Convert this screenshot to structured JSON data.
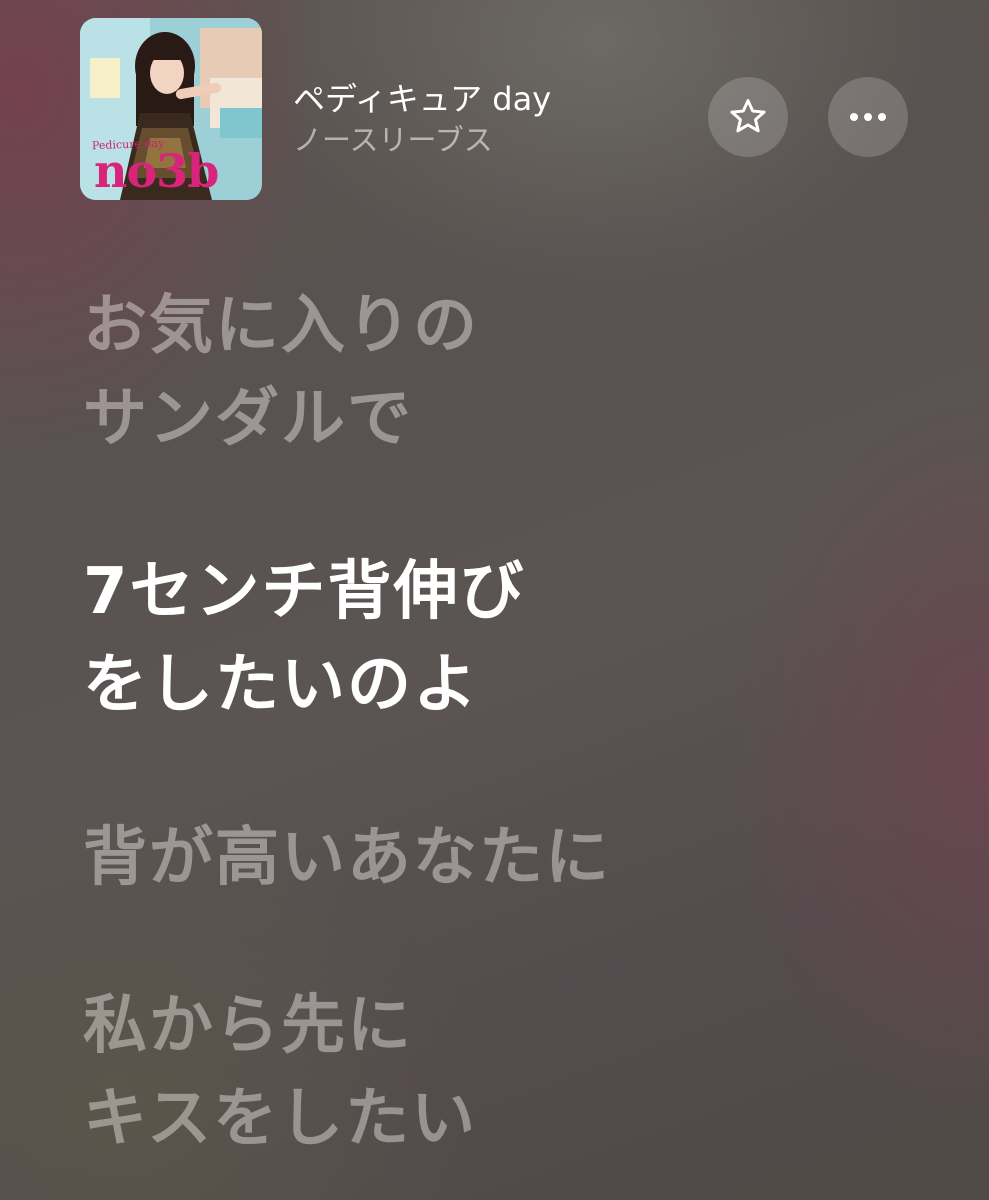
{
  "now_playing": {
    "title": "ペディキュア day",
    "artist": "ノースリーブス",
    "album_art": {
      "text_brand": "no3b",
      "text_sub": "Pedicure day"
    }
  },
  "actions": {
    "favorite_icon": "star-icon",
    "more_icon": "ellipsis-icon"
  },
  "lyrics": [
    {
      "text": "お気に入りの\nサンダルで",
      "active": false
    },
    {
      "text": "7センチ背伸び\nをしたいのよ",
      "active": true
    },
    {
      "text": "背が高いあなたに",
      "active": false
    },
    {
      "text": "私から先に\nキスをしたい",
      "active": false
    }
  ],
  "colors": {
    "active_lyric": "#ffffff",
    "inactive_lyric": "#eee6e6",
    "album_brand": "#d8247a"
  }
}
